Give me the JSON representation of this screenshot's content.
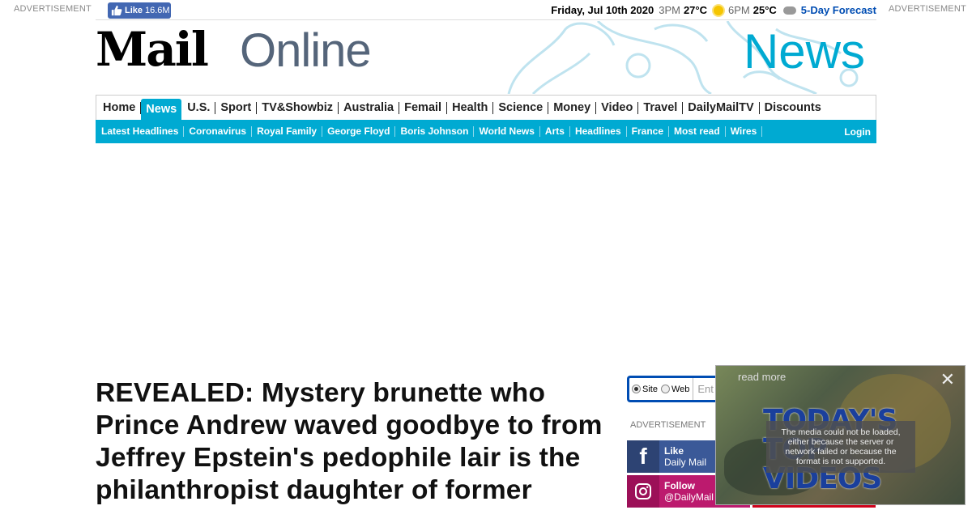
{
  "ads": {
    "left_label": "ADVERTISEMENT",
    "right_label": "ADVERTISEMENT",
    "side_label": "ADVERTISEMENT"
  },
  "facebook_like": {
    "label": "Like",
    "count": "16.6M"
  },
  "weather": {
    "date": "Friday, Jul 10th 2020",
    "time1": "3PM",
    "temp1": "27°C",
    "time2": "6PM",
    "temp2": "25°C",
    "forecast_link": "5-Day Forecast"
  },
  "masthead": {
    "logo_part1": "Mail",
    "logo_part2": "Online",
    "section": "News"
  },
  "nav": {
    "items": [
      "Home",
      "News",
      "U.S.",
      "Sport",
      "TV&Showbiz",
      "Australia",
      "Femail",
      "Health",
      "Science",
      "Money",
      "Video",
      "Travel",
      "DailyMailTV",
      "Discounts"
    ],
    "active": "News"
  },
  "subnav": {
    "items": [
      "Latest Headlines",
      "Coronavirus",
      "Royal Family",
      "George Floyd",
      "Boris Johnson",
      "World News",
      "Arts",
      "Headlines",
      "France",
      "Most read",
      "Wires"
    ],
    "login": "Login"
  },
  "article": {
    "headline": "REVEALED: Mystery brunette who Prince Andrew waved goodbye to from Jeffrey Epstein's pedophile lair is the philanthropist daughter of former"
  },
  "search": {
    "option_site": "Site",
    "option_web": "Web",
    "placeholder": "Ent",
    "selected": "Site"
  },
  "social": {
    "facebook": {
      "action": "Like",
      "account": "Daily Mail"
    },
    "instagram": {
      "action": "Follow",
      "account": "@DailyMail"
    }
  },
  "video_popup": {
    "read_more": "read more",
    "close": "✕",
    "title": "TODAY'S TOP VIDEOS",
    "error": "The media could not be loaded, either because the server or network failed or because the format is not supported."
  },
  "colors": {
    "accent": "#00aad2",
    "link": "#004db3",
    "facebook": "#3b5998",
    "instagram": "#bc1a6e"
  }
}
